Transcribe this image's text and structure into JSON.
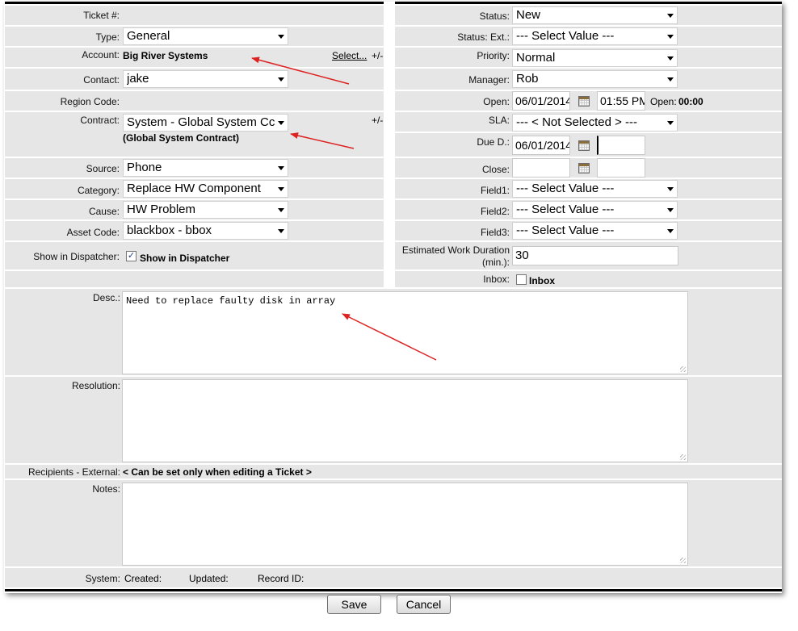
{
  "left": {
    "ticket_label": "Ticket #:",
    "type_label": "Type:",
    "type_value": "General",
    "account_label": "Account:",
    "account_value": "Big River Systems",
    "account_select_link": "Select...",
    "account_toggle": "+/-",
    "contact_label": "Contact:",
    "contact_value": "jake",
    "region_label": "Region Code:",
    "contract_label": "Contract:",
    "contract_value": "System - Global System Cc",
    "contract_note": "(Global System Contract)",
    "contract_toggle": "+/-",
    "source_label": "Source:",
    "source_value": "Phone",
    "category_label": "Category:",
    "category_value": "Replace HW Component",
    "cause_label": "Cause:",
    "cause_value": "HW Problem",
    "asset_label": "Asset Code:",
    "asset_value": "blackbox - bbox",
    "dispatcher_label": "Show in Dispatcher:",
    "dispatcher_checkbox_label": "Show in Dispatcher",
    "dispatcher_checked": true
  },
  "right": {
    "status_label": "Status:",
    "status_value": "New",
    "status_ext_label": "Status: Ext.:",
    "status_ext_value": "--- Select Value ---",
    "priority_label": "Priority:",
    "priority_value": "Normal",
    "manager_label": "Manager:",
    "manager_value": "Rob",
    "open_label": "Open:",
    "open_date": "06/01/2014",
    "open_time": "01:55 PM",
    "open_duration_label": "Open:",
    "open_duration_value": "00:00",
    "sla_label": "SLA:",
    "sla_value": "--- < Not Selected > ---",
    "due_label": "Due D.:",
    "due_date": "06/01/2014",
    "due_time": "",
    "close_label": "Close:",
    "close_date": "",
    "close_time": "",
    "field1_label": "Field1:",
    "field1_value": "--- Select Value ---",
    "field2_label": "Field2:",
    "field2_value": "--- Select Value ---",
    "field3_label": "Field3:",
    "field3_value": "--- Select Value ---",
    "duration_label_1": "Estimated Work Duration",
    "duration_label_2": "(min.):",
    "duration_value": "30",
    "inbox_label": "Inbox:",
    "inbox_checkbox_label": "Inbox",
    "inbox_checked": false
  },
  "bottom": {
    "desc_label": "Desc.:",
    "desc_value": "Need to replace faulty disk in array",
    "resolution_label": "Resolution:",
    "resolution_value": "",
    "recipients_label": "Recipients - External:",
    "recipients_value": "< Can be set only when editing a Ticket >",
    "notes_label": "Notes:",
    "notes_value": "",
    "system_label": "System:",
    "created_label": "Created:",
    "updated_label": "Updated:",
    "record_label": "Record ID:"
  },
  "buttons": {
    "save": "Save",
    "cancel": "Cancel"
  },
  "colors": {
    "row_bg": "#e6e6e6",
    "annotation_arrow": "#dd2222"
  }
}
